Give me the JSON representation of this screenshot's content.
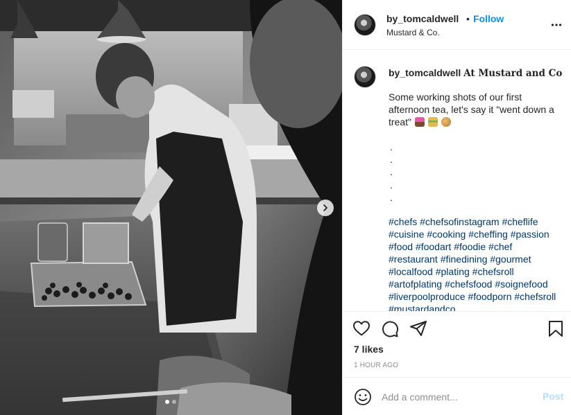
{
  "post": {
    "username": "by_tomcaldwell",
    "separator": "•",
    "follow_label": "Follow",
    "location": "Mustard & Co.",
    "more_icon": "more-horizontal-icon"
  },
  "caption": {
    "username": "by_tomcaldwell",
    "location_text": "At Mustard and Co",
    "body": "Some working shots of our first afternoon tea, let's say it \"went down a treat\"",
    "emojis": [
      "cupcake-emoji",
      "sandwich-emoji",
      "croissant-emoji"
    ],
    "bullets": [
      ".",
      ".",
      ".",
      ".",
      "."
    ],
    "hashtags": [
      "#chefs",
      "#chefsofinstagram",
      "#cheflife",
      "#cuisine",
      "#cooking",
      "#cheffing",
      "#passion",
      "#food",
      "#foodart",
      "#foodie",
      "#chef",
      "#restaurant",
      "#finedining",
      "#gourmet",
      "#localfood",
      "#plating",
      "#chefsroll",
      "#artofplating",
      "#chefsfood",
      "#soignefood",
      "#liverpoolproduce",
      "#foodporn",
      "#chefsroll",
      "#mustardandco"
    ]
  },
  "actions": {
    "icons": [
      "heart-icon",
      "comment-icon",
      "share-icon",
      "bookmark-icon"
    ],
    "likes": "7 likes",
    "time_ago": "1 HOUR AGO"
  },
  "comment_box": {
    "placeholder": "Add a comment...",
    "post_label": "Post",
    "emoji_icon": "smiley-icon"
  },
  "carousel": {
    "next_icon": "chevron-right-icon",
    "slide_count": 2,
    "active_slide": 1
  },
  "colors": {
    "link_blue": "#0095f6",
    "hashtag_blue": "#00376b",
    "muted_gray": "#8e8e8e",
    "post_disabled": "#b2dffc",
    "text": "#262626"
  }
}
